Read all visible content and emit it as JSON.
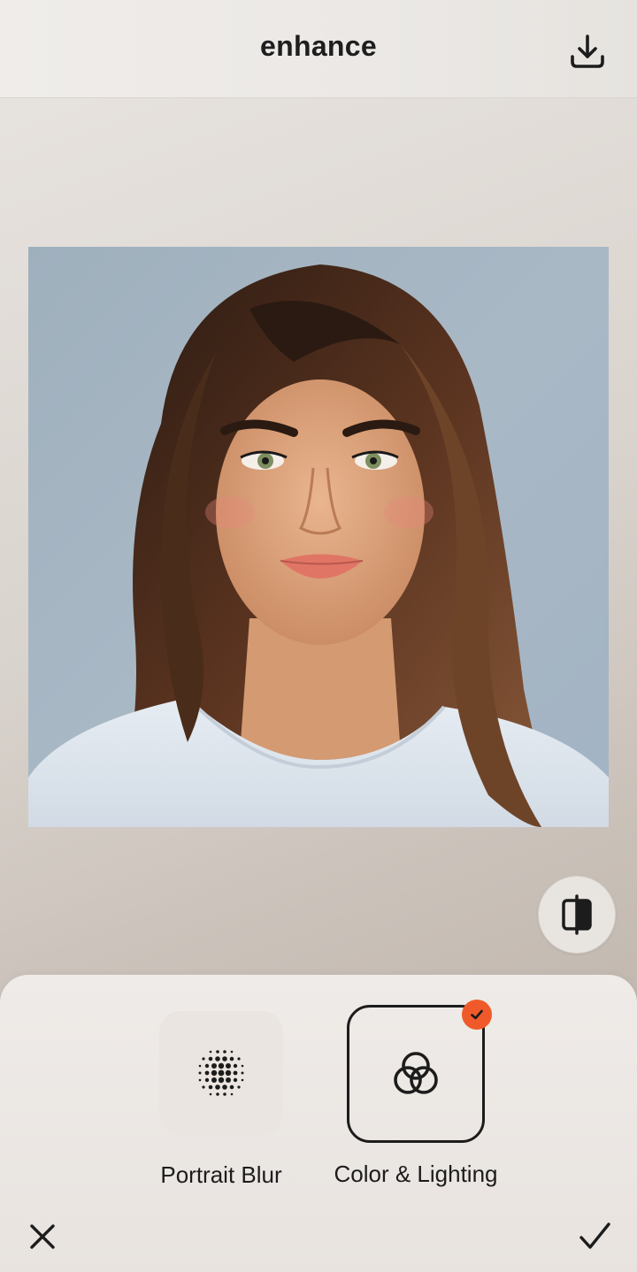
{
  "header": {
    "title": "enhance",
    "download_icon": "download-icon"
  },
  "canvas": {
    "compare_icon": "split-compare-icon"
  },
  "tools": [
    {
      "label": "Portrait Blur",
      "icon": "dot-grid-icon",
      "selected": false
    },
    {
      "label": "Color & Lighting",
      "icon": "interlocking-circles-icon",
      "selected": true
    }
  ],
  "footer": {
    "cancel_icon": "close-icon",
    "confirm_icon": "checkmark-icon"
  },
  "colors": {
    "accent": "#f05a2a",
    "ink": "#1c1c1c"
  }
}
